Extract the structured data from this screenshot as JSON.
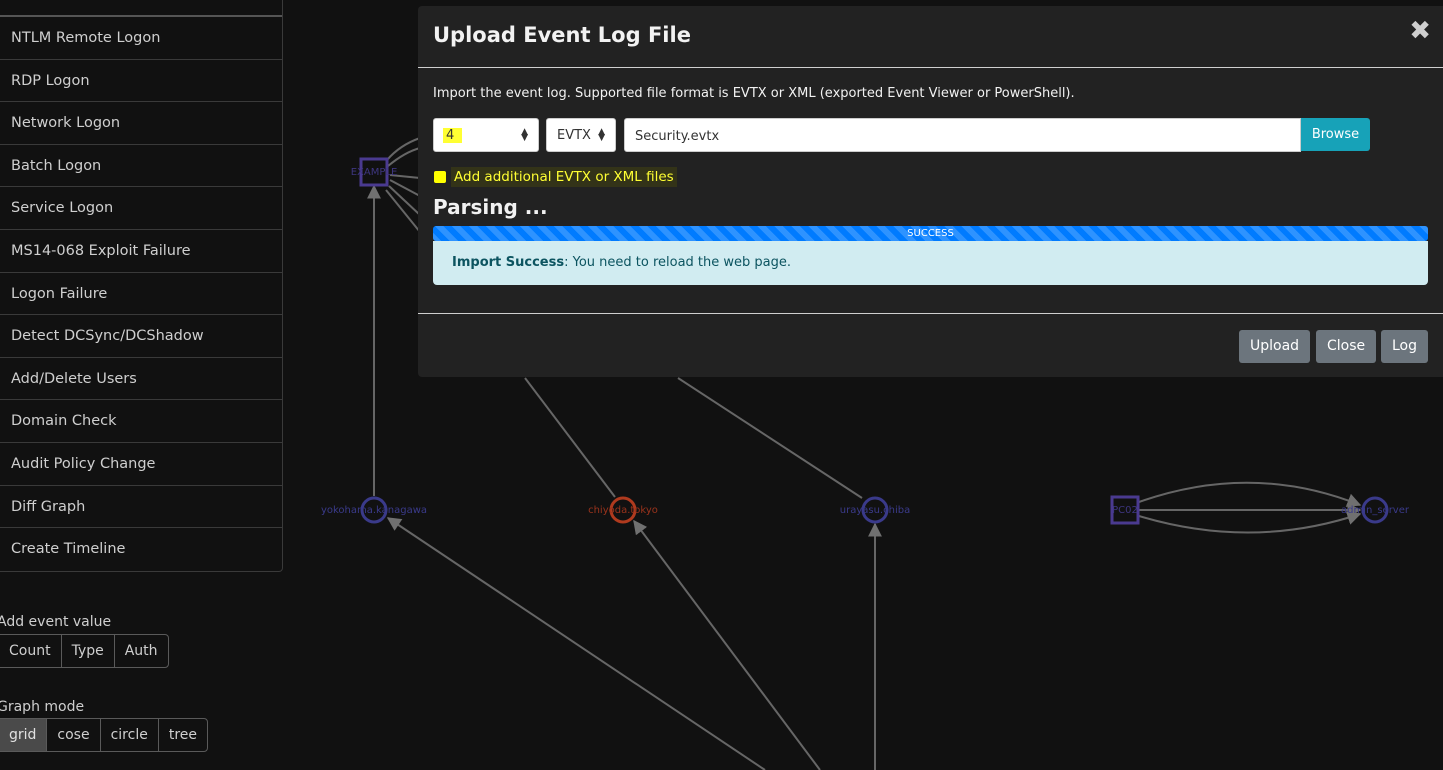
{
  "sidebar": {
    "items": [
      {
        "label": "NTLM Remote Logon"
      },
      {
        "label": "RDP Logon"
      },
      {
        "label": "Network Logon"
      },
      {
        "label": "Batch Logon"
      },
      {
        "label": "Service Logon"
      },
      {
        "label": "MS14-068 Exploit Failure"
      },
      {
        "label": "Logon Failure"
      },
      {
        "label": "Detect DCSync/DCShadow"
      },
      {
        "label": "Add/Delete Users"
      },
      {
        "label": "Domain Check"
      },
      {
        "label": "Audit Policy Change"
      },
      {
        "label": "Diff Graph"
      },
      {
        "label": "Create Timeline"
      }
    ],
    "event_value": {
      "label": "Add event value",
      "buttons": [
        "Count",
        "Type",
        "Auth"
      ]
    },
    "graph_mode": {
      "label": "Graph mode",
      "buttons": [
        "grid",
        "cose",
        "circle",
        "tree"
      ],
      "active": "grid"
    }
  },
  "graph": {
    "nodes": {
      "example": "EXAMPLE",
      "yokohama": "yokohama.kanagawa",
      "chiyoda": "chiyoda.tokyo",
      "urayasu": "urayasu.chiba",
      "pc02": "PC02",
      "admin": "admin_server"
    },
    "colors": {
      "user": "#3a3a8a",
      "host": "#4a3a90",
      "alert": "#b03a1e",
      "edge": "#6a6a6a"
    }
  },
  "modal": {
    "title": "Upload Event Log File",
    "close_icon": "close-icon",
    "description": "Import the event log. Supported file format is EVTX or XML (exported Event Viewer or PowerShell).",
    "timezone_select": "4",
    "format_select": "EVTX",
    "file_name": "Security.evtx",
    "browse_label": "Browse",
    "additional_label": "Add additional EVTX or XML files",
    "parsing_label": "Parsing ...",
    "progress": {
      "percent": 100,
      "label": "SUCCESS"
    },
    "alert": {
      "strong": "Import Success",
      "text": ": You need to reload the web page."
    },
    "buttons": {
      "upload": "Upload",
      "close": "Close",
      "log": "Log"
    }
  }
}
